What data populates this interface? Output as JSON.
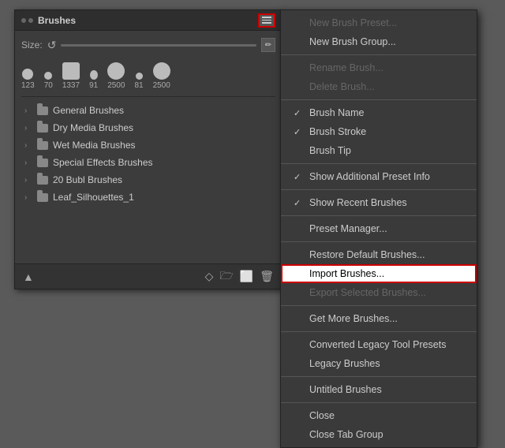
{
  "panel": {
    "title": "Brushes",
    "size_label": "Size:",
    "menu_button_label": "≡",
    "brush_icons": [
      {
        "size": 14,
        "num": "123"
      },
      {
        "size": 10,
        "num": "70"
      },
      {
        "size": 22,
        "num": "1337"
      },
      {
        "size": 12,
        "num": "91"
      },
      {
        "size": 22,
        "num": "2500"
      },
      {
        "size": 9,
        "num": "81"
      },
      {
        "size": 22,
        "num": "2500"
      }
    ],
    "brush_groups": [
      {
        "name": "General Brushes"
      },
      {
        "name": "Dry Media Brushes"
      },
      {
        "name": "Wet Media Brushes"
      },
      {
        "name": "Special Effects Brushes"
      },
      {
        "name": "20 Bubl Brushes"
      },
      {
        "name": "Leaf_Silhouettes_1"
      }
    ]
  },
  "menu": {
    "items": [
      {
        "id": "new-brush-preset",
        "label": "New Brush Preset...",
        "disabled": true,
        "check": ""
      },
      {
        "id": "new-brush-group",
        "label": "New Brush Group...",
        "disabled": false,
        "check": ""
      },
      {
        "id": "divider1"
      },
      {
        "id": "rename-brush",
        "label": "Rename Brush...",
        "disabled": true,
        "check": ""
      },
      {
        "id": "delete-brush",
        "label": "Delete Brush...",
        "disabled": true,
        "check": ""
      },
      {
        "id": "divider2"
      },
      {
        "id": "brush-name",
        "label": "Brush Name",
        "disabled": false,
        "check": "✓"
      },
      {
        "id": "brush-stroke",
        "label": "Brush Stroke",
        "disabled": false,
        "check": "✓"
      },
      {
        "id": "brush-tip",
        "label": "Brush Tip",
        "disabled": false,
        "check": ""
      },
      {
        "id": "divider3"
      },
      {
        "id": "show-additional",
        "label": "Show Additional Preset Info",
        "disabled": false,
        "check": "✓"
      },
      {
        "id": "divider4"
      },
      {
        "id": "show-recent",
        "label": "Show Recent Brushes",
        "disabled": false,
        "check": "✓"
      },
      {
        "id": "divider5"
      },
      {
        "id": "preset-manager",
        "label": "Preset Manager...",
        "disabled": false,
        "check": ""
      },
      {
        "id": "divider6"
      },
      {
        "id": "restore-default",
        "label": "Restore Default Brushes...",
        "disabled": false,
        "check": ""
      },
      {
        "id": "import-brushes",
        "label": "Import Brushes...",
        "disabled": false,
        "check": "",
        "highlighted": true
      },
      {
        "id": "export-selected",
        "label": "Export Selected Brushes...",
        "disabled": true,
        "check": ""
      },
      {
        "id": "divider7"
      },
      {
        "id": "get-more",
        "label": "Get More Brushes...",
        "disabled": false,
        "check": ""
      },
      {
        "id": "divider8"
      },
      {
        "id": "converted-legacy",
        "label": "Converted Legacy Tool Presets",
        "disabled": false,
        "check": ""
      },
      {
        "id": "legacy-brushes",
        "label": "Legacy Brushes",
        "disabled": false,
        "check": ""
      },
      {
        "id": "divider9"
      },
      {
        "id": "untitled-brushes",
        "label": "Untitled Brushes",
        "disabled": false,
        "check": ""
      },
      {
        "id": "divider10"
      },
      {
        "id": "close",
        "label": "Close",
        "disabled": false,
        "check": ""
      },
      {
        "id": "close-tab-group",
        "label": "Close Tab Group",
        "disabled": false,
        "check": ""
      }
    ]
  }
}
